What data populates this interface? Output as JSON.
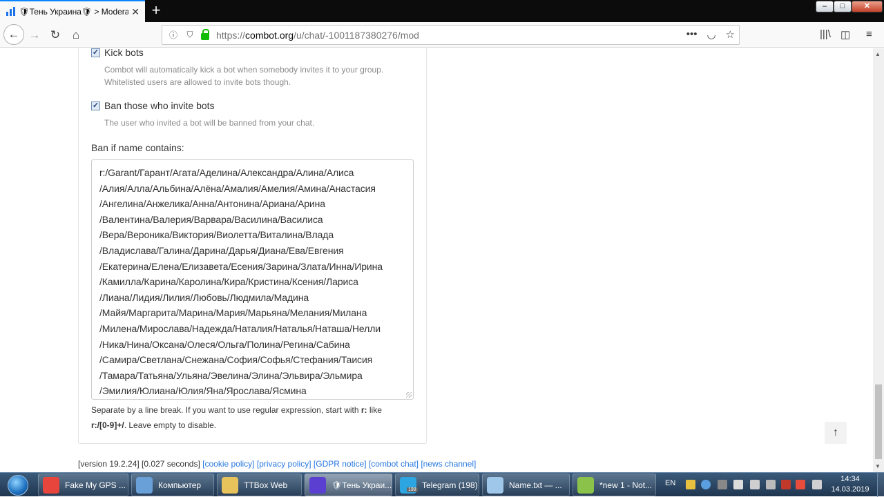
{
  "browser": {
    "tab_title": "🛡Тень Украина🛡 > Moderati",
    "url_prefix": "https://",
    "url_host": "combot.org",
    "url_path": "/u/chat/-1001187380276/mod"
  },
  "settings": {
    "kick_bots": {
      "label": "Kick bots",
      "checked": true,
      "hint_line1": "Combot will automatically kick a bot when somebody invites it to your group.",
      "hint_line2": "Whitelisted users are allowed to invite bots though."
    },
    "ban_inviters": {
      "label": "Ban those who invite bots",
      "checked": true,
      "hint": "The user who invited a bot will be banned from your chat."
    },
    "ban_name": {
      "label": "Ban if name contains:",
      "lines": [
        "r:/Garant/Гарант/Агата/Аделина/Александра/Алина/Алиса",
        "/Алия/Алла/Альбина/Алёна/Амалия/Амелия/Амина/Анастасия",
        "/Ангелина/Анжелика/Анна/Антонина/Ариана/Арина",
        "/Валентина/Валерия/Варвара/Василина/Василиса",
        "/Вера/Вероника/Виктория/Виолетта/Виталина/Влада",
        "/Владислава/Галина/Дарина/Дарья/Диана/Ева/Евгения",
        "/Екатерина/Елена/Елизавета/Есения/Зарина/Злата/Инна/Ирина",
        "/Камилла/Карина/Каролина/Кира/Кристина/Ксения/Лариса",
        "/Лиана/Лидия/Лилия/Любовь/Людмила/Мадина",
        "/Майя/Маргарита/Марина/Мария/Марьяна/Мелания/Милана",
        "/Милена/Мирослава/Надежда/Наталия/Наталья/Наташа/Нелли",
        "/Ника/Нина/Оксана/Олеся/Ольга/Полина/Регина/Сабина",
        "/Самира/Светлана/Снежана/София/Софья/Стефания/Таисия",
        "/Тамара/Татьяна/Ульяна/Эвелина/Элина/Эльвира/Эльмира",
        "/Эмилия/Юлиана/Юлия/Яна/Ярослава/Ясмина"
      ],
      "help_a": "Separate by a line break. If you want to use regular expression, start with ",
      "help_b": "r:",
      "help_c": " like",
      "help_d": "r:/[0-9]+/",
      "help_e": ". Leave empty to disable."
    }
  },
  "scroll_top_glyph": "↑",
  "footer": {
    "version": "[version 19.2.24] [0.027 seconds]",
    "links": [
      "[cookie policy]",
      "[privacy policy]",
      "[GDPR notice]",
      "[combot chat]",
      "[news channel]"
    ]
  },
  "taskbar": {
    "items": [
      {
        "label": "Fake My GPS ...",
        "color": "#e8453c"
      },
      {
        "label": "Компьютер",
        "color": "#6aa0d8"
      },
      {
        "label": "TTBox Web",
        "color": "#e8c25a"
      },
      {
        "label": "🛡Тень Украи...",
        "color": "#5b3fd0"
      },
      {
        "label": "Telegram (198)",
        "color": "#2ca5e0"
      },
      {
        "label": "Name.txt — ...",
        "color": "#9fc7ea"
      },
      {
        "label": "*new 1 - Not...",
        "color": "#8bc34a"
      }
    ],
    "telegram_badge": "198",
    "lang": "EN",
    "time": "14:34",
    "date": "14.03.2019"
  }
}
